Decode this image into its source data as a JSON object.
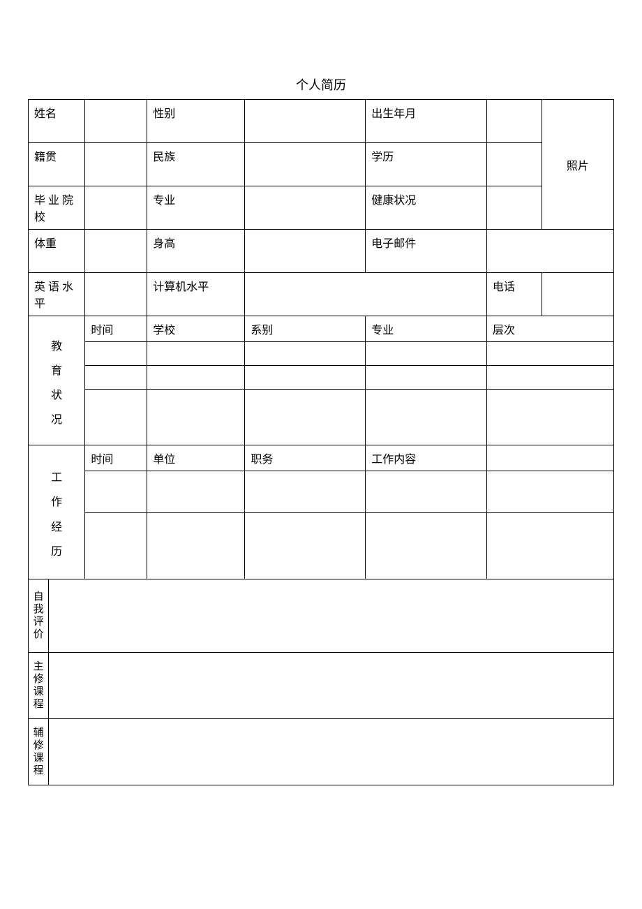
{
  "title": "个人简历",
  "labels": {
    "name": "姓名",
    "gender": "性别",
    "birth": "出生年月",
    "photo": "照片",
    "native_place": "籍贯",
    "ethnicity": "民族",
    "education_level": "学历",
    "grad_school": "毕 业 院校",
    "major": "专业",
    "health": "健康状况",
    "weight": "体重",
    "height": "身高",
    "email": "电子邮件",
    "english_level": "英 语 水平",
    "computer_level": "计算机水平",
    "phone": "电话"
  },
  "education": {
    "section": "教育状况",
    "headers": {
      "time": "时间",
      "school": "学校",
      "department": "系别",
      "major": "专业",
      "level": "层次"
    }
  },
  "work": {
    "section": "工作经历",
    "headers": {
      "time": "时间",
      "unit": "单位",
      "position": "职务",
      "content": "工作内容"
    }
  },
  "sections": {
    "self_eval": "自我评价",
    "main_courses": "主修课程",
    "minor_courses": "辅修课程"
  }
}
